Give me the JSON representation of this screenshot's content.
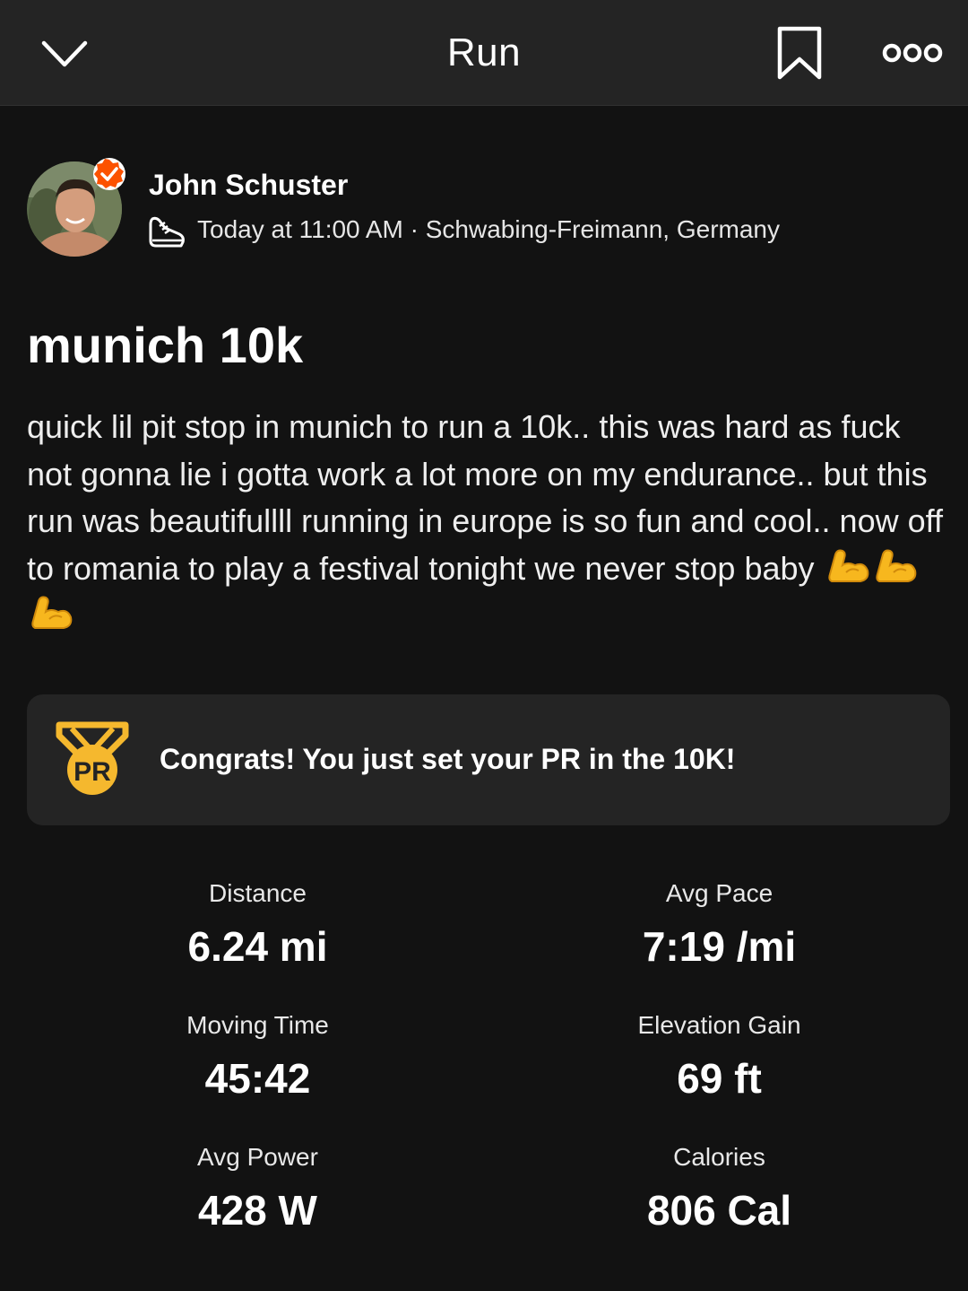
{
  "header": {
    "title": "Run",
    "back_icon": "chevron-down-icon",
    "bookmark_icon": "bookmark-icon",
    "more_icon": "more-options-icon"
  },
  "author": {
    "name": "John Schuster",
    "verified_color": "#FC5200",
    "activity_icon": "running-shoe-icon",
    "meta": "Today at 11:00 AM · Schwabing-Freimann, Germany"
  },
  "activity": {
    "title": "munich 10k",
    "description": "quick lil pit stop in munich to run a 10k.. this was hard as fuck not gonna lie i gotta work a lot more on my endurance.. but this run was beautifullll running in europe is so fun and cool.. now off to romania to play a festival tonight we never stop baby",
    "emojis": [
      "flexed-biceps",
      "flexed-biceps",
      "flexed-biceps"
    ]
  },
  "pr_banner": {
    "text": "Congrats! You just set your PR in the 10K!",
    "icon": "pr-medal-icon",
    "badge_label": "PR",
    "accent": "#F5B82E"
  },
  "stats": [
    {
      "label": "Distance",
      "value": "6.24 mi"
    },
    {
      "label": "Avg Pace",
      "value": "7:19 /mi"
    },
    {
      "label": "Moving Time",
      "value": "45:42"
    },
    {
      "label": "Elevation Gain",
      "value": "69 ft"
    },
    {
      "label": "Avg Power",
      "value": "428 W"
    },
    {
      "label": "Calories",
      "value": "806 Cal"
    }
  ]
}
